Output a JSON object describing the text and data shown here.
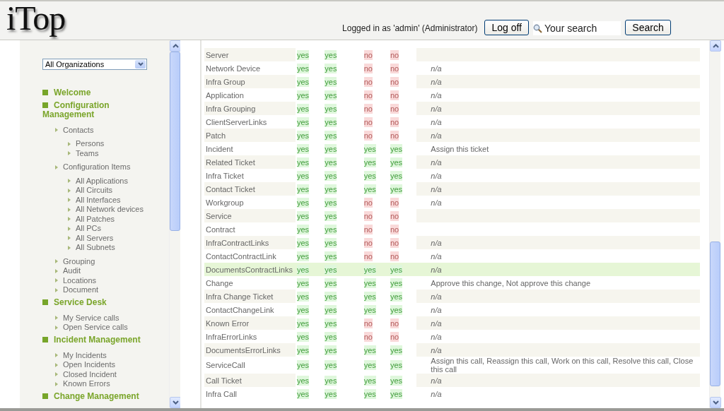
{
  "header": {
    "logo": "iTop",
    "login_text": "Logged in as 'admin' (Administrator)",
    "logoff_button": "Log off",
    "search": {
      "placeholder": "Your search"
    },
    "search_button": "Search"
  },
  "sidebar": {
    "organization": "All Organizations",
    "menu": [
      {
        "label": "Welcome"
      },
      {
        "label": "Configuration Management",
        "children": [
          {
            "label": "Contacts",
            "children": [
              {
                "label": "Persons"
              },
              {
                "label": "Teams"
              }
            ]
          },
          {
            "label": "Configuration Items",
            "children": [
              {
                "label": "All Applications"
              },
              {
                "label": "All Circuits"
              },
              {
                "label": "All Interfaces"
              },
              {
                "label": "All Network devices"
              },
              {
                "label": "All Patches"
              },
              {
                "label": "All PCs"
              },
              {
                "label": "All Servers"
              },
              {
                "label": "All Subnets"
              }
            ]
          },
          {
            "label": "Grouping"
          },
          {
            "label": "Audit"
          },
          {
            "label": "Locations"
          },
          {
            "label": "Document"
          }
        ]
      },
      {
        "label": "Service Desk",
        "children": [
          {
            "label": "My Service calls"
          },
          {
            "label": "Open Service calls"
          }
        ]
      },
      {
        "label": "Incident Management",
        "children": [
          {
            "label": "My Incidents"
          },
          {
            "label": "Open Incidents"
          },
          {
            "label": "Closed Incident"
          },
          {
            "label": "Known Errors"
          }
        ]
      },
      {
        "label": "Change Management"
      }
    ]
  },
  "table": {
    "rows": [
      {
        "name": "Server",
        "selected": false,
        "cells": [
          {
            "text": "yes",
            "allowed": true
          },
          {
            "text": "yes",
            "allowed": true
          },
          {
            "text": "no",
            "allowed": false
          },
          {
            "text": "no",
            "allowed": false
          }
        ]
      },
      {
        "name": "Network Device",
        "selected": false,
        "cells": [
          {
            "text": "yes",
            "allowed": true
          },
          {
            "text": "yes",
            "allowed": true
          },
          {
            "text": "no",
            "allowed": false
          },
          {
            "text": "no",
            "allowed": false
          }
        ],
        "kind": "na",
        "actions": "n/a"
      },
      {
        "name": "Infra Group",
        "selected": false,
        "cells": [
          {
            "text": "yes",
            "allowed": true
          },
          {
            "text": "yes",
            "allowed": true
          },
          {
            "text": "no",
            "allowed": false
          },
          {
            "text": "no",
            "allowed": false
          }
        ],
        "kind": "na",
        "actions": "n/a"
      },
      {
        "name": "Application",
        "selected": false,
        "cells": [
          {
            "text": "yes",
            "allowed": true
          },
          {
            "text": "yes",
            "allowed": true
          },
          {
            "text": "no",
            "allowed": false
          },
          {
            "text": "no",
            "allowed": false
          }
        ],
        "kind": "na",
        "actions": "n/a"
      },
      {
        "name": "Infra Grouping",
        "selected": false,
        "cells": [
          {
            "text": "yes",
            "allowed": true
          },
          {
            "text": "yes",
            "allowed": true
          },
          {
            "text": "no",
            "allowed": false
          },
          {
            "text": "no",
            "allowed": false
          }
        ],
        "kind": "na",
        "actions": "n/a"
      },
      {
        "name": "ClientServerLinks",
        "selected": false,
        "cells": [
          {
            "text": "yes",
            "allowed": true
          },
          {
            "text": "yes",
            "allowed": true
          },
          {
            "text": "no",
            "allowed": false
          },
          {
            "text": "no",
            "allowed": false
          }
        ],
        "kind": "na",
        "actions": "n/a"
      },
      {
        "name": "Patch",
        "selected": false,
        "cells": [
          {
            "text": "yes",
            "allowed": true
          },
          {
            "text": "yes",
            "allowed": true
          },
          {
            "text": "no",
            "allowed": false
          },
          {
            "text": "no",
            "allowed": false
          }
        ],
        "kind": "na",
        "actions": "n/a"
      },
      {
        "name": "Incident",
        "selected": false,
        "cells": [
          {
            "text": "yes",
            "allowed": true
          },
          {
            "text": "yes",
            "allowed": true
          },
          {
            "text": "yes",
            "allowed": true
          },
          {
            "text": "yes",
            "allowed": true
          }
        ],
        "kind": "list",
        "actions": "Assign this ticket"
      },
      {
        "name": "Related Ticket",
        "selected": false,
        "cells": [
          {
            "text": "yes",
            "allowed": true
          },
          {
            "text": "yes",
            "allowed": true
          },
          {
            "text": "yes",
            "allowed": true
          },
          {
            "text": "yes",
            "allowed": true
          }
        ],
        "kind": "na",
        "actions": "n/a"
      },
      {
        "name": "Infra Ticket",
        "selected": false,
        "cells": [
          {
            "text": "yes",
            "allowed": true
          },
          {
            "text": "yes",
            "allowed": true
          },
          {
            "text": "yes",
            "allowed": true
          },
          {
            "text": "yes",
            "allowed": true
          }
        ],
        "kind": "na",
        "actions": "n/a"
      },
      {
        "name": "Contact Ticket",
        "selected": false,
        "cells": [
          {
            "text": "yes",
            "allowed": true
          },
          {
            "text": "yes",
            "allowed": true
          },
          {
            "text": "yes",
            "allowed": true
          },
          {
            "text": "yes",
            "allowed": true
          }
        ],
        "kind": "na",
        "actions": "n/a"
      },
      {
        "name": "Workgroup",
        "selected": false,
        "cells": [
          {
            "text": "yes",
            "allowed": true
          },
          {
            "text": "yes",
            "allowed": true
          },
          {
            "text": "no",
            "allowed": false
          },
          {
            "text": "no",
            "allowed": false
          }
        ],
        "kind": "na",
        "actions": "n/a"
      },
      {
        "name": "Service",
        "selected": false,
        "cells": [
          {
            "text": "yes",
            "allowed": true
          },
          {
            "text": "yes",
            "allowed": true
          },
          {
            "text": "no",
            "allowed": false
          },
          {
            "text": "no",
            "allowed": false
          }
        ]
      },
      {
        "name": "Contract",
        "selected": false,
        "cells": [
          {
            "text": "yes",
            "allowed": true
          },
          {
            "text": "yes",
            "allowed": true
          },
          {
            "text": "no",
            "allowed": false
          },
          {
            "text": "no",
            "allowed": false
          }
        ]
      },
      {
        "name": "InfraContractLinks",
        "selected": false,
        "cells": [
          {
            "text": "yes",
            "allowed": true
          },
          {
            "text": "yes",
            "allowed": true
          },
          {
            "text": "no",
            "allowed": false
          },
          {
            "text": "no",
            "allowed": false
          }
        ],
        "kind": "na",
        "actions": "n/a"
      },
      {
        "name": "ContactContractLink",
        "selected": false,
        "cells": [
          {
            "text": "yes",
            "allowed": true
          },
          {
            "text": "yes",
            "allowed": true
          },
          {
            "text": "no",
            "allowed": false
          },
          {
            "text": "no",
            "allowed": false
          }
        ],
        "kind": "na",
        "actions": "n/a"
      },
      {
        "name": "DocumentsContractLinks",
        "selected": true,
        "cells": [
          {
            "text": "yes",
            "allowed": true
          },
          {
            "text": "yes",
            "allowed": true
          },
          {
            "text": "yes",
            "allowed": true
          },
          {
            "text": "yes",
            "allowed": true
          }
        ],
        "kind": "na",
        "actions": "n/a"
      },
      {
        "name": "Change",
        "selected": false,
        "cells": [
          {
            "text": "yes",
            "allowed": true
          },
          {
            "text": "yes",
            "allowed": true
          },
          {
            "text": "yes",
            "allowed": true
          },
          {
            "text": "yes",
            "allowed": true
          }
        ],
        "kind": "list",
        "actions": "Approve this change, Not approve this change"
      },
      {
        "name": "Infra Change Ticket",
        "selected": false,
        "cells": [
          {
            "text": "yes",
            "allowed": true
          },
          {
            "text": "yes",
            "allowed": true
          },
          {
            "text": "yes",
            "allowed": true
          },
          {
            "text": "yes",
            "allowed": true
          }
        ],
        "kind": "na",
        "actions": "n/a"
      },
      {
        "name": "ContactChangeLink",
        "selected": false,
        "cells": [
          {
            "text": "yes",
            "allowed": true
          },
          {
            "text": "yes",
            "allowed": true
          },
          {
            "text": "yes",
            "allowed": true
          },
          {
            "text": "yes",
            "allowed": true
          }
        ],
        "kind": "na",
        "actions": "n/a"
      },
      {
        "name": "Known Error",
        "selected": false,
        "cells": [
          {
            "text": "yes",
            "allowed": true
          },
          {
            "text": "yes",
            "allowed": true
          },
          {
            "text": "no",
            "allowed": false
          },
          {
            "text": "no",
            "allowed": false
          }
        ],
        "kind": "na",
        "actions": "n/a"
      },
      {
        "name": "InfraErrorLinks",
        "selected": false,
        "cells": [
          {
            "text": "yes",
            "allowed": true
          },
          {
            "text": "yes",
            "allowed": true
          },
          {
            "text": "no",
            "allowed": false
          },
          {
            "text": "no",
            "allowed": false
          }
        ],
        "kind": "na",
        "actions": "n/a"
      },
      {
        "name": "DocumentsErrorLinks",
        "selected": false,
        "cells": [
          {
            "text": "yes",
            "allowed": true
          },
          {
            "text": "yes",
            "allowed": true
          },
          {
            "text": "yes",
            "allowed": true
          },
          {
            "text": "yes",
            "allowed": true
          }
        ],
        "kind": "na",
        "actions": "n/a"
      },
      {
        "name": "ServiceCall",
        "selected": false,
        "cells": [
          {
            "text": "yes",
            "allowed": true
          },
          {
            "text": "yes",
            "allowed": true
          },
          {
            "text": "yes",
            "allowed": true
          },
          {
            "text": "yes",
            "allowed": true
          }
        ],
        "kind": "list",
        "actions": "Assign this call, Reassign this call, Work on this call, Resolve this call, Close this call"
      },
      {
        "name": "Call Ticket",
        "selected": false,
        "cells": [
          {
            "text": "yes",
            "allowed": true
          },
          {
            "text": "yes",
            "allowed": true
          },
          {
            "text": "yes",
            "allowed": true
          },
          {
            "text": "yes",
            "allowed": true
          }
        ],
        "kind": "na",
        "actions": "n/a"
      },
      {
        "name": "Infra Call",
        "selected": false,
        "cells": [
          {
            "text": "yes",
            "allowed": true
          },
          {
            "text": "yes",
            "allowed": true
          },
          {
            "text": "yes",
            "allowed": true
          },
          {
            "text": "yes",
            "allowed": true
          }
        ],
        "kind": "na",
        "actions": "n/a"
      }
    ]
  }
}
